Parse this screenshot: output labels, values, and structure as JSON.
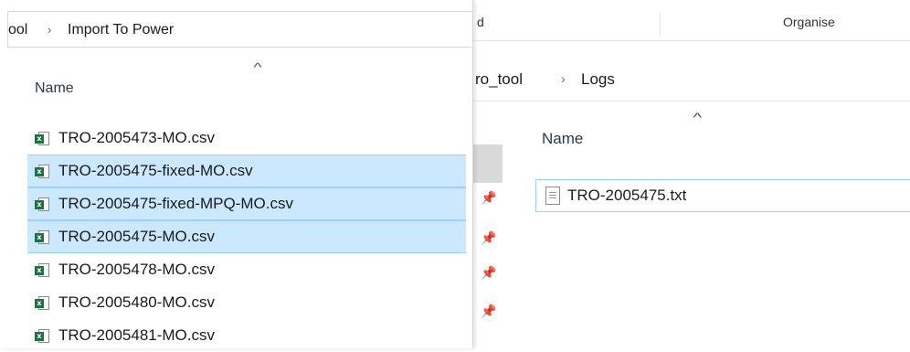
{
  "back_window": {
    "ribbon": {
      "left_fragment": "d",
      "organise_label": "Organise"
    },
    "address": {
      "segments": [
        "ro_tool",
        "Logs"
      ],
      "separator": "›"
    },
    "column_header": "Name",
    "files": [
      {
        "name": "TRO-2005475.txt",
        "icon": "text-file-icon"
      }
    ],
    "pins": [
      "pin-icon",
      "pin-icon",
      "pin-icon",
      "pin-icon"
    ]
  },
  "front_window": {
    "address": {
      "segments": [
        "ool",
        "Import To Power"
      ],
      "separator": "›"
    },
    "column_header": "Name",
    "files": [
      {
        "name": "TRO-2005473-MO.csv",
        "selected": false
      },
      {
        "name": "TRO-2005475-fixed-MO.csv",
        "selected": true
      },
      {
        "name": "TRO-2005475-fixed-MPQ-MO.csv",
        "selected": true
      },
      {
        "name": "TRO-2005475-MO.csv",
        "selected": true
      },
      {
        "name": "TRO-2005478-MO.csv",
        "selected": false
      },
      {
        "name": "TRO-2005480-MO.csv",
        "selected": false
      },
      {
        "name": "TRO-2005481-MO.csv",
        "selected": false
      }
    ],
    "icon_badge": "x"
  },
  "colors": {
    "selection": "#cce8ff",
    "selection_border": "#99d1ff",
    "excel_green": "#1e7145"
  },
  "glyphs": {
    "sort_caret": "^",
    "pin": "📌"
  }
}
